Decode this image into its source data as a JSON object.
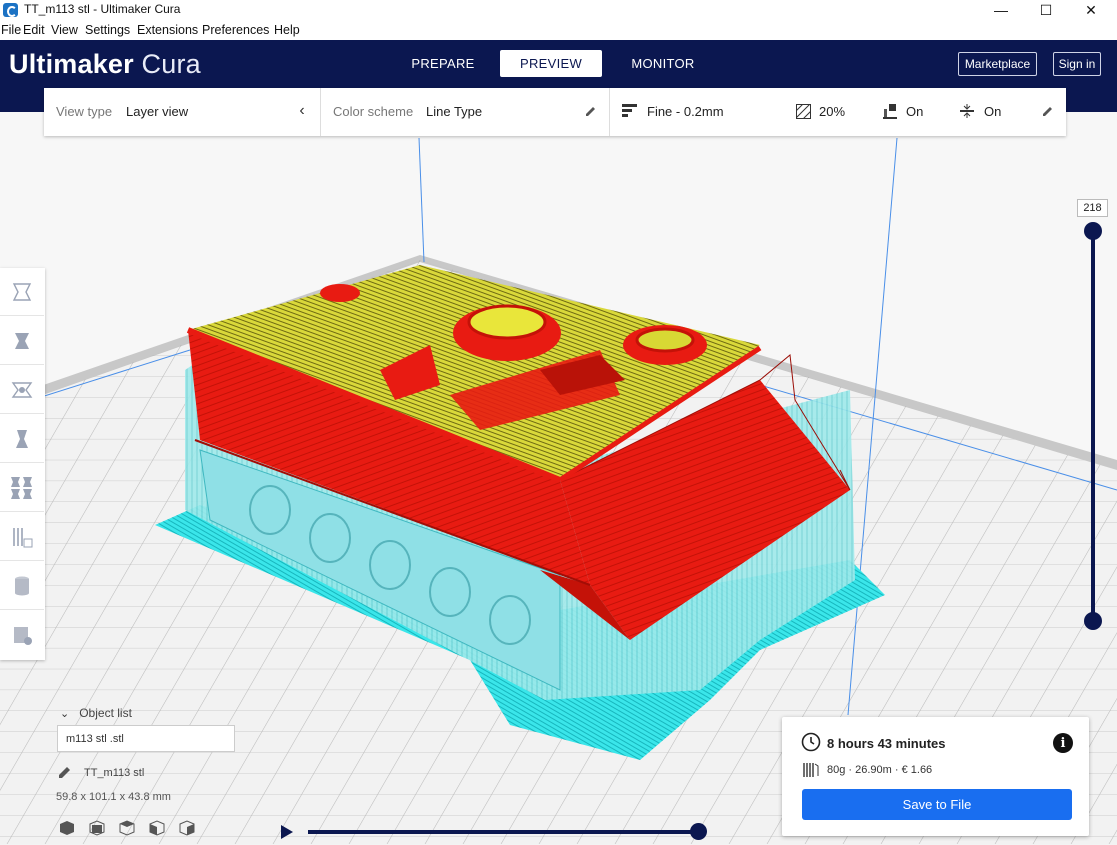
{
  "window": {
    "title": "TT_m113 stl  - Ultimaker Cura",
    "controls": [
      "—",
      "☐",
      "✕"
    ]
  },
  "menu": [
    "File",
    "Edit",
    "View",
    "Settings",
    "Extensions",
    "Preferences",
    "Help"
  ],
  "header": {
    "logo_bold": "Ultimaker",
    "logo_light": " Cura",
    "tabs": [
      "PREPARE",
      "PREVIEW",
      "MONITOR"
    ],
    "active_tab": "PREVIEW",
    "marketplace": "Marketplace",
    "signin": "Sign in"
  },
  "view_toolbar": {
    "view_type_label": "View type",
    "view_type_value": "Layer view",
    "color_scheme_label": "Color scheme",
    "color_scheme_value": "Line Type",
    "profile": "Fine - 0.2mm",
    "infill": "20%",
    "support": "On",
    "adhesion": "On"
  },
  "layer_slider": {
    "current_layer": "218"
  },
  "object_list": {
    "title": "Object list",
    "file_entry": "m113 stl .stl",
    "object_name": "TT_m113 stl",
    "dimensions": "59.8 x 101.1 x 43.8 mm"
  },
  "print_info": {
    "time": "8 hours 43 minutes",
    "material": "80g · 26.90m · € 1.66",
    "save_label": "Save to File"
  },
  "colors": {
    "header_bg": "#0b1750",
    "wall": "#e81b12",
    "skin": "#e6e634",
    "support": "#37e8e8",
    "save_button": "#196ef0"
  }
}
